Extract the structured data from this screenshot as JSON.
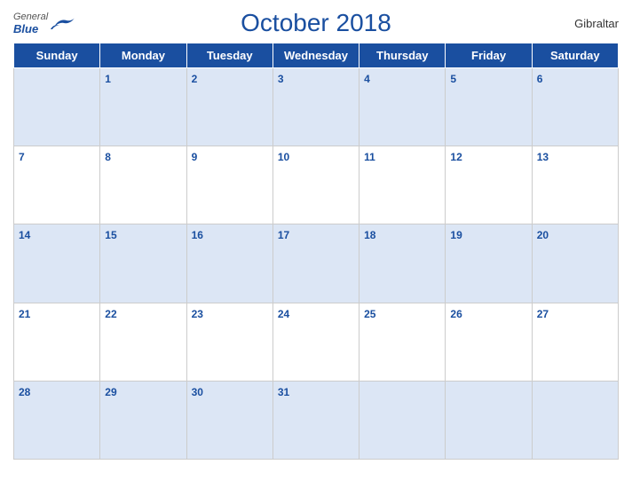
{
  "header": {
    "month_year": "October 2018",
    "region": "Gibraltar",
    "logo_general": "General",
    "logo_blue": "Blue"
  },
  "days_of_week": [
    "Sunday",
    "Monday",
    "Tuesday",
    "Wednesday",
    "Thursday",
    "Friday",
    "Saturday"
  ],
  "weeks": [
    [
      null,
      1,
      2,
      3,
      4,
      5,
      6
    ],
    [
      7,
      8,
      9,
      10,
      11,
      12,
      13
    ],
    [
      14,
      15,
      16,
      17,
      18,
      19,
      20
    ],
    [
      21,
      22,
      23,
      24,
      25,
      26,
      27
    ],
    [
      28,
      29,
      30,
      31,
      null,
      null,
      null
    ]
  ],
  "row_styles": [
    "blue",
    "white",
    "blue",
    "white",
    "blue"
  ]
}
